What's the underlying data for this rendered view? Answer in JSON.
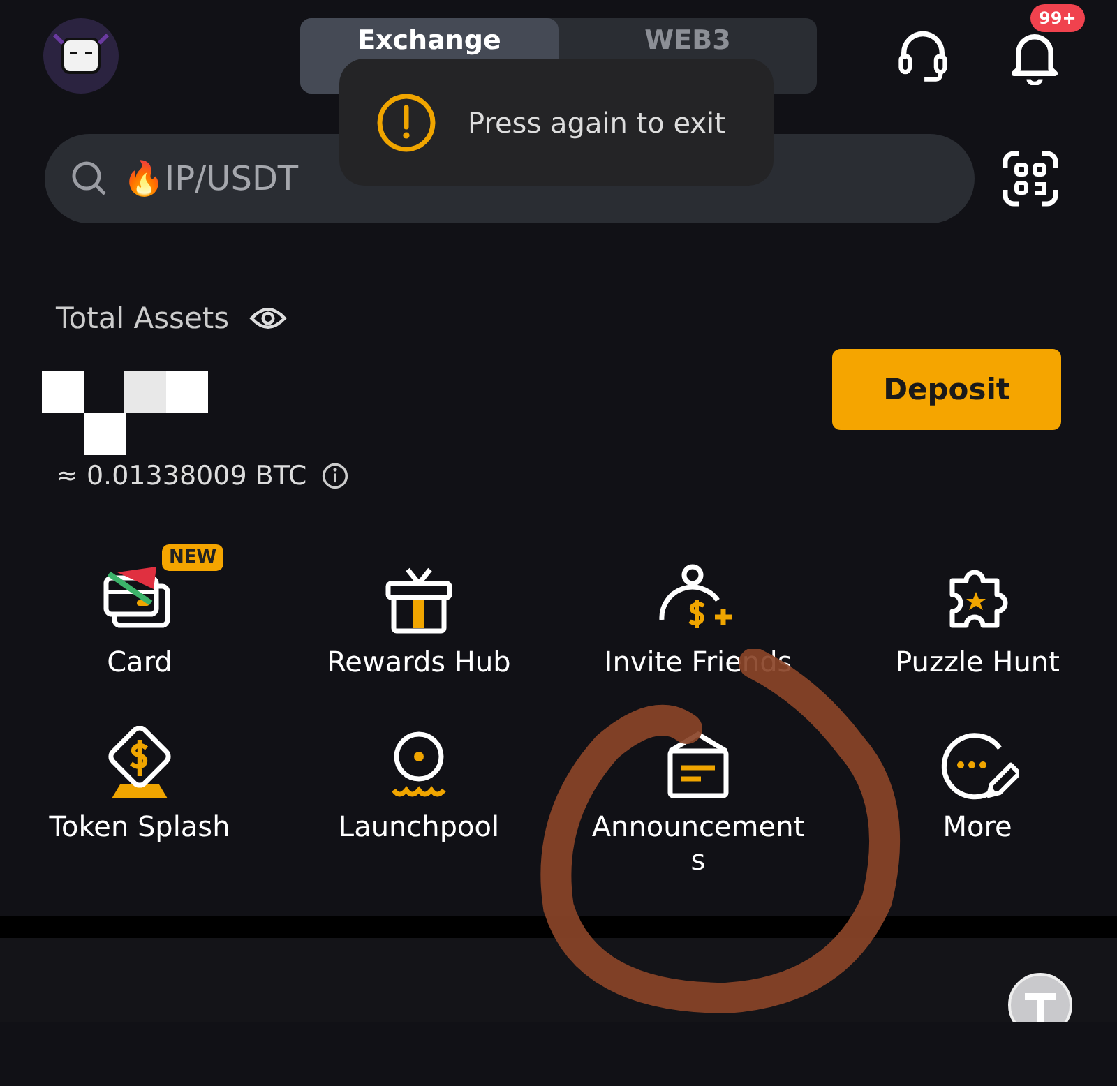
{
  "header": {
    "tabs": [
      {
        "label": "Exchange",
        "selected": true
      },
      {
        "label": "WEB3",
        "selected": false
      }
    ],
    "notification_badge": "99+"
  },
  "toast": {
    "message": "Press again to exit"
  },
  "search": {
    "placeholder": "🔥IP/USDT"
  },
  "assets": {
    "label": "Total Assets",
    "btc_value": "≈ 0.01338009 BTC",
    "deposit_button": "Deposit"
  },
  "shortcuts": [
    {
      "label": "Card",
      "badge": "NEW"
    },
    {
      "label": "Rewards Hub"
    },
    {
      "label": "Invite Friends"
    },
    {
      "label": "Puzzle Hunt"
    },
    {
      "label": "Token Splash"
    },
    {
      "label": "Launchpool"
    },
    {
      "label": "Announcements"
    },
    {
      "label": "More"
    }
  ]
}
